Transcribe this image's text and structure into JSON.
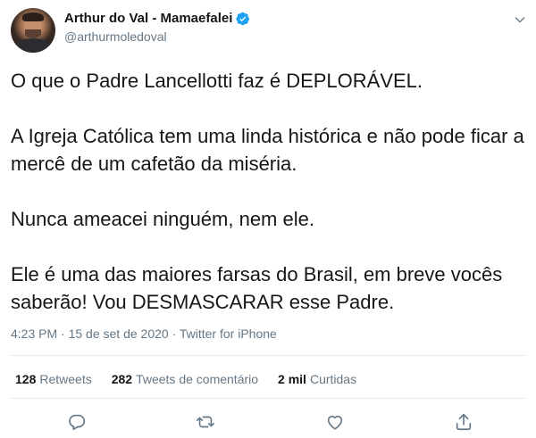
{
  "author": {
    "name": "Arthur do Val - Mamaefalei",
    "handle": "@arthurmoledoval"
  },
  "tweet": {
    "paragraphs": [
      "O que o Padre Lancellotti faz é DEPLORÁVEL.",
      "A Igreja Católica tem uma linda histórica e não pode ficar a mercê de um cafetão da miséria.",
      "Nunca ameacei ninguém, nem ele.",
      "Ele é uma das maiores farsas do Brasil, em breve vocês saberão! Vou DESMASCARAR esse Padre."
    ],
    "meta": "4:23 PM · 15 de set de 2020 · Twitter for iPhone"
  },
  "stats": {
    "retweets_count": "128",
    "retweets_label": "Retweets",
    "quotes_count": "282",
    "quotes_label": "Tweets de comentário",
    "likes_count": "2 mil",
    "likes_label": "Curtidas"
  },
  "icons": {
    "verified": "verified-badge-icon",
    "menu": "chevron-down-icon",
    "reply": "reply-icon",
    "retweet": "retweet-icon",
    "like": "heart-icon",
    "share": "share-icon"
  },
  "colors": {
    "text": "#14171a",
    "secondary": "#657786",
    "verified": "#1da1f2",
    "divider": "#e6ecf0"
  }
}
